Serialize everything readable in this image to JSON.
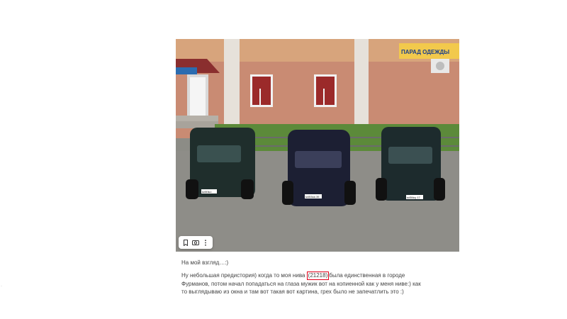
{
  "photo": {
    "store_sign": "ПАРАД ОДЕЖДЫ",
    "plates": [
      "м453ко",
      "м453аа 35",
      "м454ку 17"
    ]
  },
  "toolbar": {
    "bookmark_icon": "bookmark-icon",
    "camera_icon": "camera-icon",
    "more_icon": "more-vertical-icon"
  },
  "post": {
    "caption": "На мой взгляд…:)",
    "text_before": "Ну небольшая предистория) когда то моя нива ",
    "highlighted": "(21218)",
    "text_after": "была единственная в городе Фурманов, потом начал попадаться на глаза мужик вот на копиенной как у меня ниве:) как то выглядываю из окна и там вот такая вот картина, грех было не запечатлить это :)"
  },
  "colors": {
    "highlight_border": "#e0001b",
    "text": "#444444"
  },
  "side_mark": "·"
}
